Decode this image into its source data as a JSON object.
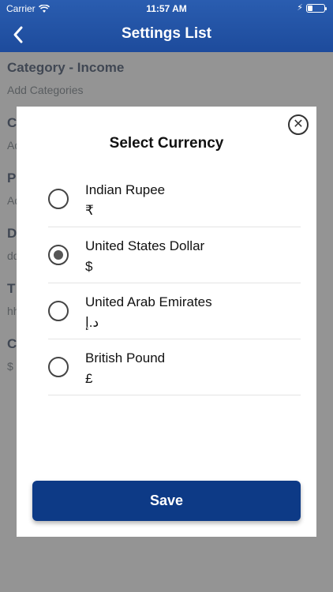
{
  "status_bar": {
    "carrier": "Carrier",
    "time": "11:57 AM"
  },
  "nav": {
    "title": "Settings List"
  },
  "background_list": [
    {
      "heading": "Category - Income",
      "sub": "Add Categories"
    },
    {
      "heading": "C",
      "sub": "Ad"
    },
    {
      "heading": "P",
      "sub": "Ad"
    },
    {
      "heading": "D",
      "sub": "dd"
    },
    {
      "heading": "T",
      "sub": "hh"
    },
    {
      "heading": "C",
      "sub": "$"
    }
  ],
  "modal": {
    "title": "Select Currency",
    "options": [
      {
        "name": "Indian Rupee",
        "symbol": "₹",
        "selected": false
      },
      {
        "name": "United States Dollar",
        "symbol": "$",
        "selected": true
      },
      {
        "name": "United Arab Emirates",
        "symbol": "د.إ",
        "selected": false
      },
      {
        "name": "British Pound",
        "symbol": "£",
        "selected": false
      }
    ],
    "save_label": "Save"
  },
  "colors": {
    "nav": "#1d4b9c",
    "save_button": "#0d3a86"
  }
}
